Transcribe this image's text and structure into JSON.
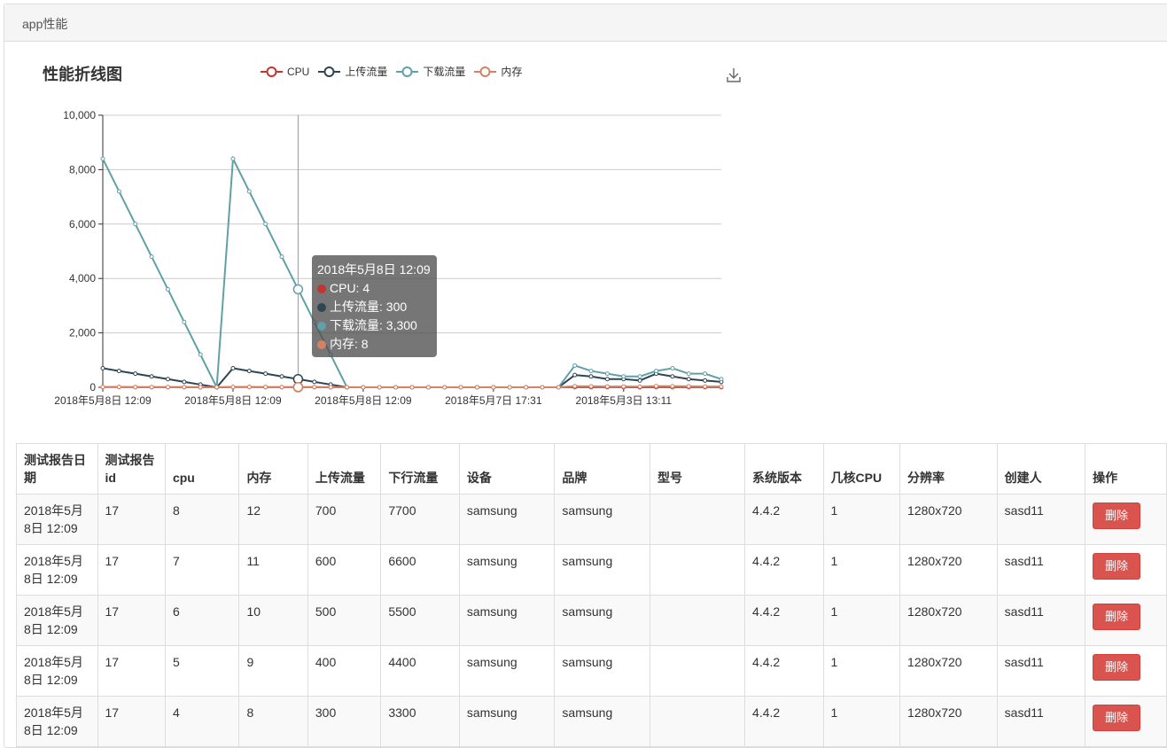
{
  "header": {
    "title": "app性能"
  },
  "chart_title": "性能折线图",
  "legend": [
    {
      "name": "CPU",
      "color": "#c23531"
    },
    {
      "name": "上传流量",
      "color": "#2f4554"
    },
    {
      "name": "下载流量",
      "color": "#61a0a8"
    },
    {
      "name": "内存",
      "color": "#d48265"
    }
  ],
  "download_icon": "download-icon",
  "chart_data": {
    "type": "line",
    "ylim": [
      0,
      10000
    ],
    "yticks": [
      "10,000",
      "8,000",
      "6,000",
      "4,000",
      "2,000",
      "0"
    ],
    "xtick_labels": [
      "2018年5月8日 12:09",
      "2018年5月8日 12:09",
      "2018年5月8日 12:09",
      "2018年5月7日 17:31",
      "2018年5月3日 13:11"
    ],
    "n_points": 39,
    "series": [
      {
        "name": "CPU",
        "color": "#c23531",
        "values": [
          8,
          7,
          6,
          5,
          4,
          3,
          2,
          1,
          8,
          7,
          6,
          5,
          4,
          3,
          2,
          1,
          0,
          0,
          0,
          0,
          0,
          0,
          0,
          0,
          0,
          0,
          0,
          0,
          0,
          5,
          4,
          3,
          3,
          2,
          6,
          5,
          4,
          3,
          3
        ]
      },
      {
        "name": "上传流量",
        "color": "#2f4554",
        "values": [
          700,
          600,
          500,
          400,
          300,
          200,
          100,
          0,
          700,
          600,
          500,
          400,
          300,
          200,
          100,
          0,
          0,
          0,
          0,
          0,
          0,
          0,
          0,
          0,
          0,
          0,
          0,
          0,
          0,
          450,
          400,
          300,
          300,
          250,
          500,
          400,
          300,
          250,
          200
        ]
      },
      {
        "name": "下载流量",
        "color": "#61a0a8",
        "values": [
          8400,
          7200,
          6000,
          4800,
          3600,
          2400,
          1200,
          0,
          8400,
          7200,
          6000,
          4800,
          3600,
          2400,
          1200,
          0,
          0,
          0,
          0,
          0,
          0,
          0,
          0,
          0,
          0,
          0,
          0,
          0,
          0,
          800,
          600,
          500,
          400,
          400,
          600,
          700,
          500,
          500,
          300
        ]
      },
      {
        "name": "内存",
        "color": "#d48265",
        "values": [
          12,
          11,
          10,
          9,
          8,
          7,
          6,
          5,
          12,
          11,
          10,
          9,
          8,
          7,
          6,
          5,
          0,
          0,
          0,
          0,
          0,
          0,
          0,
          0,
          0,
          0,
          0,
          0,
          0,
          40,
          35,
          30,
          30,
          25,
          45,
          40,
          35,
          30,
          30
        ]
      }
    ],
    "highlight_index": 12
  },
  "tooltip": {
    "title": "2018年5月8日 12:09",
    "rows": [
      {
        "label": "CPU: 4",
        "color": "#c23531"
      },
      {
        "label": "上传流量: 300",
        "color": "#2f4554"
      },
      {
        "label": "下载流量: 3,300",
        "color": "#61a0a8"
      },
      {
        "label": "内存: 8",
        "color": "#d48265"
      }
    ]
  },
  "table": {
    "headers": [
      "测试报告日期",
      "测试报告id",
      "cpu",
      "内存",
      "上传流量",
      "下行流量",
      "设备",
      "品牌",
      "型号",
      "系统版本",
      "几核CPU",
      "分辨率",
      "创建人",
      "操作"
    ],
    "delete_label": "删除",
    "rows": [
      [
        "2018年5月8日 12:09",
        "17",
        "8",
        "12",
        "700",
        "7700",
        "samsung",
        "samsung",
        "",
        "4.4.2",
        "1",
        "1280x720",
        "sasd11"
      ],
      [
        "2018年5月8日 12:09",
        "17",
        "7",
        "11",
        "600",
        "6600",
        "samsung",
        "samsung",
        "",
        "4.4.2",
        "1",
        "1280x720",
        "sasd11"
      ],
      [
        "2018年5月8日 12:09",
        "17",
        "6",
        "10",
        "500",
        "5500",
        "samsung",
        "samsung",
        "",
        "4.4.2",
        "1",
        "1280x720",
        "sasd11"
      ],
      [
        "2018年5月8日 12:09",
        "17",
        "5",
        "9",
        "400",
        "4400",
        "samsung",
        "samsung",
        "",
        "4.4.2",
        "1",
        "1280x720",
        "sasd11"
      ],
      [
        "2018年5月8日 12:09",
        "17",
        "4",
        "8",
        "300",
        "3300",
        "samsung",
        "samsung",
        "",
        "4.4.2",
        "1",
        "1280x720",
        "sasd11"
      ]
    ]
  }
}
